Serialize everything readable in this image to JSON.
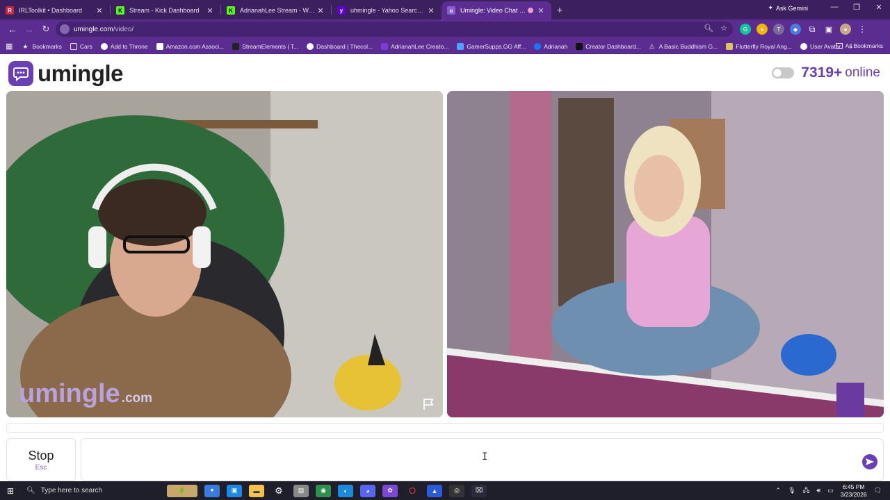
{
  "browser": {
    "tabs": [
      {
        "title": "IRLToolkit • Dashboard",
        "favicon": "IRLToolkit",
        "color": "#c6283f"
      },
      {
        "title": "Stream - Kick Dashboard",
        "favicon": "K",
        "color": "#53fc18"
      },
      {
        "title": "AdrianahLee Stream - Watch Live",
        "favicon": "K",
        "color": "#53fc18"
      },
      {
        "title": "uhmingle - Yahoo Search Results",
        "favicon": "y",
        "color": "#6001d2"
      },
      {
        "title": "Umingle: Video Chat with Strangers",
        "favicon": "u",
        "color": "#8a5cd6"
      }
    ],
    "active_tab_index": 4,
    "ask_gemini": "Ask Gemini",
    "url_host": "umingle.com",
    "url_path": "/video/",
    "bookmarks": [
      "Bookmarks",
      "Cars",
      "Add to Throne",
      "Amazon.com Associ...",
      "StreamElements | T...",
      "Dashboard | Thecol...",
      "AdrianahLee Creato...",
      "GamerSupps.GG Aff...",
      "Adrianah",
      "Creator Dashboard...",
      "A Basic Buddhism G...",
      "Flutterfly Royal Ang...",
      "User Avatar"
    ],
    "all_bookmarks": "All Bookmarks",
    "theme_color": "#5b2d91"
  },
  "site": {
    "logo_text": "umingle",
    "online_count": "7319+",
    "online_label": "online",
    "watermark_main": "umingle",
    "watermark_suffix": ".com",
    "stop_label": "Stop",
    "stop_hint": "Esc",
    "chat_placeholder": "",
    "accent": "#6a3fb5"
  },
  "taskbar": {
    "search_placeholder": "Type here to search",
    "time": "6:45 PM",
    "date": "3/23/2026"
  }
}
